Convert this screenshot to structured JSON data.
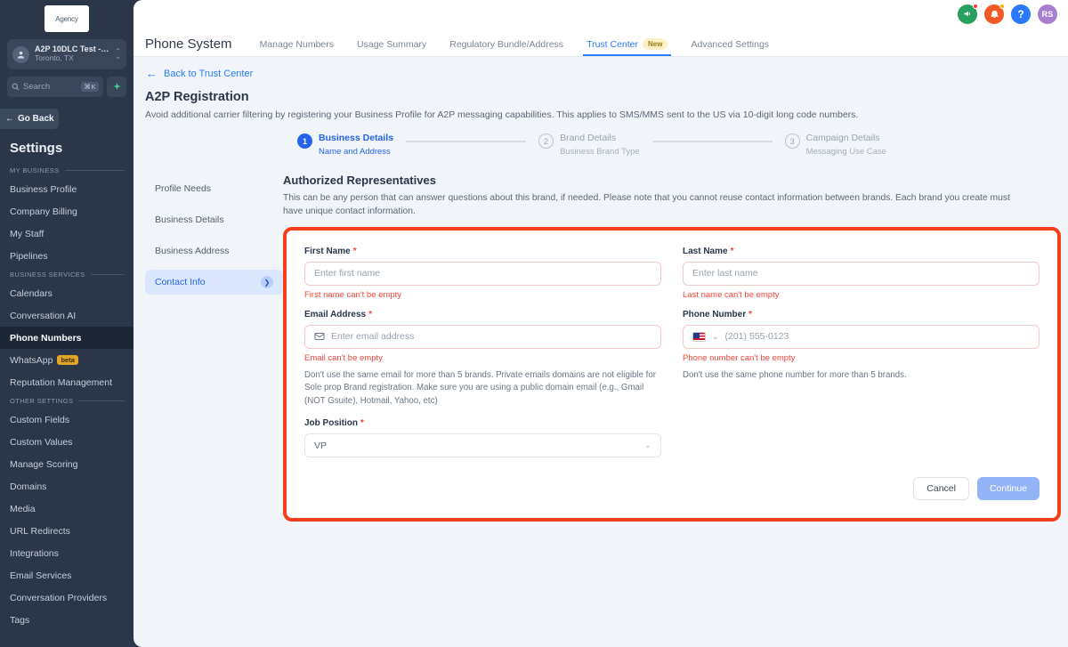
{
  "sidebar": {
    "logo_text": "Agency",
    "account": {
      "name": "A2P 10DLC Test - Sh…",
      "location": "Toronto, TX"
    },
    "search": {
      "placeholder": "Search",
      "shortcut": "⌘K"
    },
    "go_back_label": "Go Back",
    "settings_title": "Settings",
    "groups": [
      {
        "label": "MY BUSINESS",
        "items": [
          {
            "label": "Business Profile"
          },
          {
            "label": "Company Billing"
          },
          {
            "label": "My Staff"
          },
          {
            "label": "Pipelines"
          }
        ]
      },
      {
        "label": "BUSINESS SERVICES",
        "items": [
          {
            "label": "Calendars"
          },
          {
            "label": "Conversation AI"
          },
          {
            "label": "Phone Numbers",
            "active": true
          },
          {
            "label": "WhatsApp",
            "badge": "beta"
          },
          {
            "label": "Reputation Management"
          }
        ]
      },
      {
        "label": "OTHER SETTINGS",
        "items": [
          {
            "label": "Custom Fields"
          },
          {
            "label": "Custom Values"
          },
          {
            "label": "Manage Scoring"
          },
          {
            "label": "Domains"
          },
          {
            "label": "Media"
          },
          {
            "label": "URL Redirects"
          },
          {
            "label": "Integrations"
          },
          {
            "label": "Email Services"
          },
          {
            "label": "Conversation Providers"
          },
          {
            "label": "Tags"
          }
        ]
      }
    ]
  },
  "topbar": {
    "icons": [
      {
        "name": "megaphone-icon",
        "glyph": "📣"
      },
      {
        "name": "bell-icon",
        "glyph": "🔔"
      },
      {
        "name": "help-icon",
        "glyph": "?"
      }
    ],
    "avatar_initials": "RS"
  },
  "header": {
    "page_title": "Phone System",
    "tabs": [
      {
        "label": "Manage Numbers"
      },
      {
        "label": "Usage Summary"
      },
      {
        "label": "Regulatory Bundle/Address"
      },
      {
        "label": "Trust Center",
        "badge": "New",
        "active": true
      },
      {
        "label": "Advanced Settings"
      }
    ],
    "back_link": "Back to Trust Center"
  },
  "page": {
    "title": "A2P Registration",
    "subtitle": "Avoid additional carrier filtering by registering your Business Profile for A2P messaging capabilities. This applies to SMS/MMS sent to the US via 10-digit long code numbers.",
    "steps": [
      {
        "number": "1",
        "name": "Business Details",
        "desc": "Name and Address",
        "state": "on"
      },
      {
        "number": "2",
        "name": "Brand Details",
        "desc": "Business Brand Type",
        "state": "off"
      },
      {
        "number": "3",
        "name": "Campaign Details",
        "desc": "Messaging Use Case",
        "state": "off"
      }
    ]
  },
  "subnav": {
    "items": [
      {
        "label": "Profile Needs"
      },
      {
        "label": "Business Details"
      },
      {
        "label": "Business Address"
      },
      {
        "label": "Contact Info",
        "active": true
      }
    ]
  },
  "form": {
    "title": "Authorized Representatives",
    "description": "This can be any person that can answer questions about this brand, if needed. Please note that you cannot reuse contact information between brands. Each brand you create must have unique contact information.",
    "first_name": {
      "label": "First Name",
      "required": "*",
      "placeholder": "Enter first name",
      "value": "",
      "error": "First name can't be empty"
    },
    "last_name": {
      "label": "Last Name",
      "required": "*",
      "placeholder": "Enter last name",
      "value": "",
      "error": "Last name can't be empty"
    },
    "email": {
      "label": "Email Address",
      "required": "*",
      "placeholder": "Enter email address",
      "value": "",
      "error": "Email can't be empty",
      "hint": "Don't use the same email for more than 5 brands. Private emails domains are not eligible for Sole prop Brand registration. Make sure you are using a public domain email (e.g., Gmail (NOT Gsuite), Hotmail, Yahoo, etc)"
    },
    "phone": {
      "label": "Phone Number",
      "required": "*",
      "placeholder": "(201) 555-0123",
      "value": "",
      "country": "US",
      "error": "Phone number can't be empty",
      "hint": "Don't use the same phone number for more than 5 brands."
    },
    "job_position": {
      "label": "Job Position",
      "required": "*",
      "value": "VP"
    },
    "cancel_label": "Cancel",
    "continue_label": "Continue"
  },
  "colors": {
    "accent": "#2979ff",
    "error": "#f4433b",
    "highlight": "#f4401a",
    "sidebar": "#2b3648"
  }
}
